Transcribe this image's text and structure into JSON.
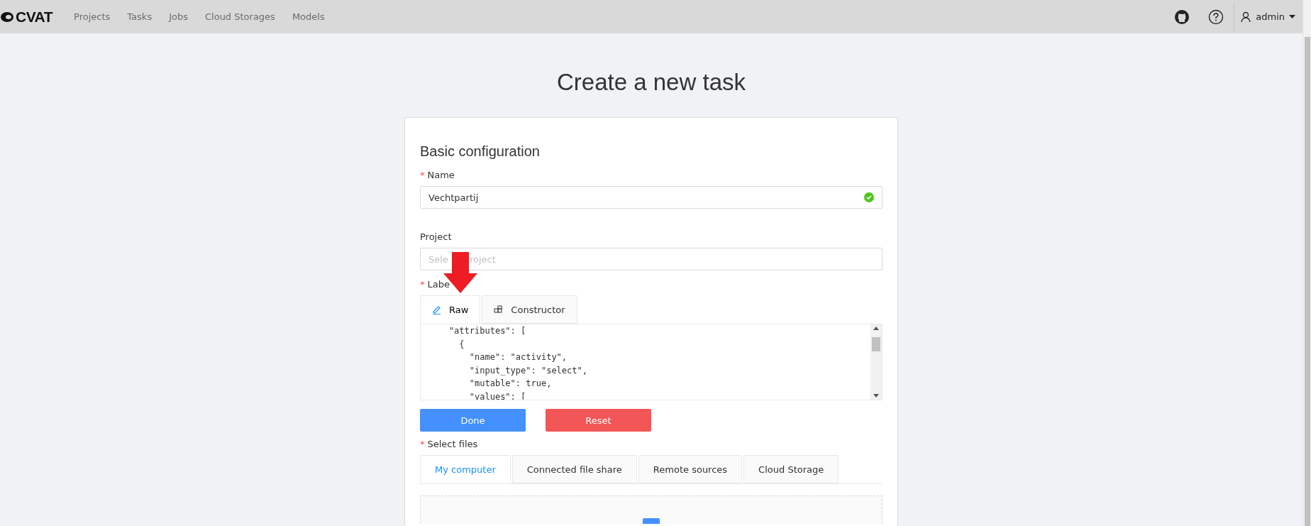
{
  "header": {
    "logo": "CVAT",
    "nav": [
      {
        "label": "Projects",
        "selected": false
      },
      {
        "label": "Tasks",
        "selected": false
      },
      {
        "label": "Jobs",
        "selected": false
      },
      {
        "label": "Cloud Storages",
        "selected": false
      },
      {
        "label": "Models",
        "selected": false
      }
    ],
    "user": "admin"
  },
  "page_title": "Create a new task",
  "card": {
    "title": "Basic configuration",
    "name_field": {
      "label": "Name",
      "required_mark": "*",
      "value": "Vechtpartij",
      "valid": true
    },
    "project_field": {
      "label": "Project",
      "placeholder_parts": [
        "Sele",
        "roject"
      ]
    },
    "labels": {
      "label": "Labe",
      "required_mark": "*",
      "tabs": [
        {
          "label": "Raw",
          "selected": true,
          "kind": "pencil"
        },
        {
          "label": "Constructor",
          "selected": false,
          "kind": "blocks"
        }
      ],
      "code_lines": [
        "    \"attributes\": [",
        "      {",
        "        \"name\": \"activity\",",
        "        \"input_type\": \"select\",",
        "        \"mutable\": true,",
        "        \"values\": ["
      ],
      "buttons": [
        {
          "label": "Done",
          "kind": "primary"
        },
        {
          "label": "Reset",
          "kind": "danger"
        }
      ]
    },
    "files": {
      "label": "Select files",
      "required_mark": "*",
      "tabs": [
        {
          "label": "My computer",
          "selected": true
        },
        {
          "label": "Connected file share",
          "selected": false
        },
        {
          "label": "Remote sources",
          "selected": false
        },
        {
          "label": "Cloud Storage",
          "selected": false
        }
      ]
    }
  }
}
